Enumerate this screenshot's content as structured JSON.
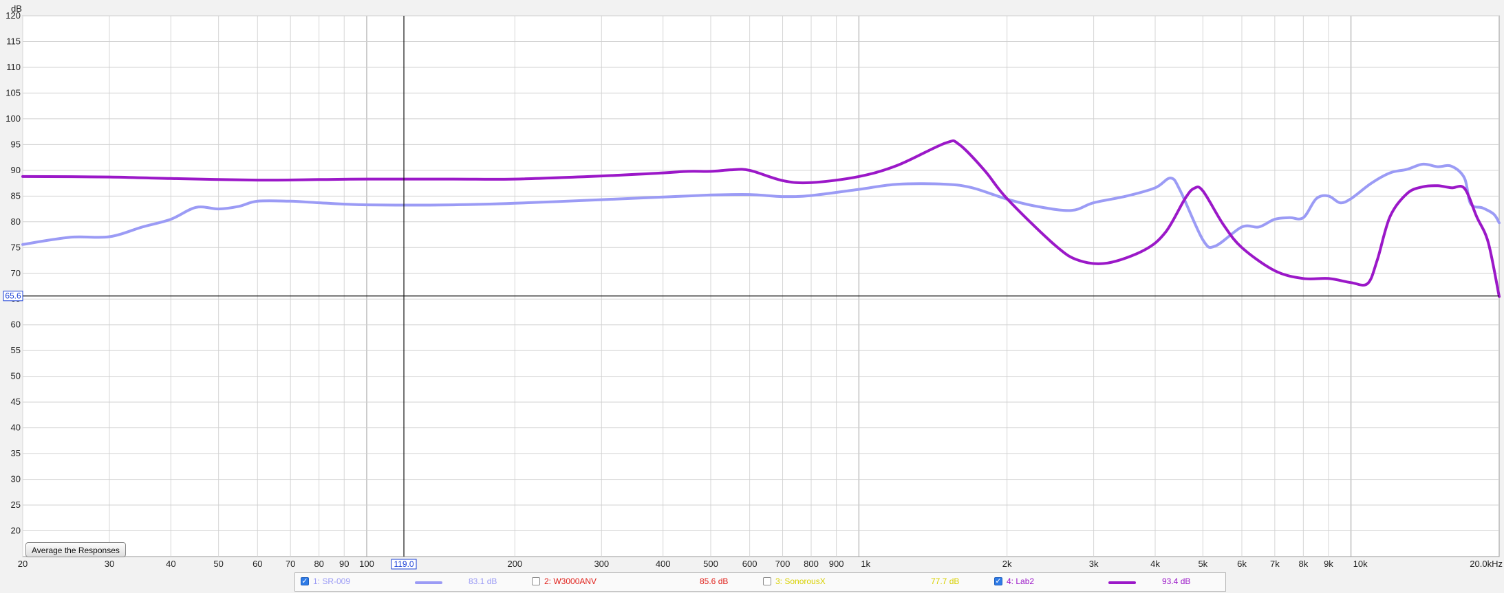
{
  "chart_data": {
    "type": "line",
    "ylabel": "dB",
    "xlim": [
      20,
      20000
    ],
    "ylim": [
      15,
      120
    ],
    "x_scale": "log",
    "grid": true,
    "x_ticks": [
      {
        "v": 20,
        "label": "20"
      },
      {
        "v": 30,
        "label": "30"
      },
      {
        "v": 40,
        "label": "40"
      },
      {
        "v": 50,
        "label": "50"
      },
      {
        "v": 60,
        "label": "60"
      },
      {
        "v": 70,
        "label": "70"
      },
      {
        "v": 80,
        "label": "80"
      },
      {
        "v": 90,
        "label": "90"
      },
      {
        "v": 100,
        "label": "100"
      },
      {
        "v": 200,
        "label": "200"
      },
      {
        "v": 300,
        "label": "300"
      },
      {
        "v": 400,
        "label": "400"
      },
      {
        "v": 500,
        "label": "500"
      },
      {
        "v": 600,
        "label": "600"
      },
      {
        "v": 700,
        "label": "700"
      },
      {
        "v": 800,
        "label": "800"
      },
      {
        "v": 900,
        "label": "900"
      },
      {
        "v": 1000,
        "label": "1k"
      },
      {
        "v": 2000,
        "label": "2k"
      },
      {
        "v": 3000,
        "label": "3k"
      },
      {
        "v": 4000,
        "label": "4k"
      },
      {
        "v": 5000,
        "label": "5k"
      },
      {
        "v": 6000,
        "label": "6k"
      },
      {
        "v": 7000,
        "label": "7k"
      },
      {
        "v": 8000,
        "label": "8k"
      },
      {
        "v": 9000,
        "label": "9k"
      },
      {
        "v": 10000,
        "label": "10k"
      },
      {
        "v": 20000,
        "label": "20.0kHz"
      }
    ],
    "y_ticks": [
      20,
      25,
      30,
      35,
      40,
      45,
      50,
      55,
      60,
      65,
      70,
      75,
      80,
      85,
      90,
      95,
      100,
      105,
      110,
      115,
      120
    ],
    "cursor": {
      "x": 119.0,
      "x_label": "119.0",
      "y": 65.6,
      "y_label": "65.6"
    },
    "series": [
      {
        "name": "SR-009",
        "color": "#9b9bf5",
        "points": [
          [
            20,
            75.6
          ],
          [
            25,
            77.0
          ],
          [
            30,
            77.1
          ],
          [
            35,
            79.0
          ],
          [
            40,
            80.5
          ],
          [
            45,
            82.8
          ],
          [
            50,
            82.5
          ],
          [
            55,
            83.0
          ],
          [
            60,
            84.0
          ],
          [
            70,
            84.0
          ],
          [
            80,
            83.7
          ],
          [
            100,
            83.3
          ],
          [
            150,
            83.3
          ],
          [
            200,
            83.6
          ],
          [
            300,
            84.3
          ],
          [
            400,
            84.8
          ],
          [
            500,
            85.2
          ],
          [
            600,
            85.3
          ],
          [
            700,
            84.9
          ],
          [
            800,
            85.1
          ],
          [
            1000,
            86.3
          ],
          [
            1200,
            87.3
          ],
          [
            1500,
            87.3
          ],
          [
            1700,
            86.6
          ],
          [
            2000,
            84.4
          ],
          [
            2300,
            83.0
          ],
          [
            2700,
            82.2
          ],
          [
            3000,
            83.7
          ],
          [
            3500,
            85.0
          ],
          [
            4000,
            86.6
          ],
          [
            4300,
            88.5
          ],
          [
            4500,
            86.0
          ],
          [
            5000,
            76.5
          ],
          [
            5300,
            75.3
          ],
          [
            6000,
            79.0
          ],
          [
            6500,
            79.0
          ],
          [
            7000,
            80.5
          ],
          [
            7500,
            80.8
          ],
          [
            8000,
            80.8
          ],
          [
            8500,
            84.5
          ],
          [
            9000,
            85.0
          ],
          [
            9500,
            83.7
          ],
          [
            10000,
            84.5
          ],
          [
            11000,
            87.5
          ],
          [
            12000,
            89.5
          ],
          [
            13000,
            90.2
          ],
          [
            14000,
            91.2
          ],
          [
            15000,
            90.7
          ],
          [
            16000,
            90.8
          ],
          [
            17000,
            88.5
          ],
          [
            17500,
            83.5
          ],
          [
            18500,
            82.7
          ],
          [
            19500,
            81.5
          ],
          [
            20000,
            79.8
          ]
        ]
      },
      {
        "name": "Lab2",
        "color": "#9b18c8",
        "points": [
          [
            20,
            88.8
          ],
          [
            30,
            88.7
          ],
          [
            40,
            88.4
          ],
          [
            60,
            88.1
          ],
          [
            80,
            88.2
          ],
          [
            100,
            88.3
          ],
          [
            150,
            88.3
          ],
          [
            200,
            88.3
          ],
          [
            300,
            88.9
          ],
          [
            400,
            89.5
          ],
          [
            450,
            89.8
          ],
          [
            500,
            89.8
          ],
          [
            550,
            90.1
          ],
          [
            600,
            90.0
          ],
          [
            700,
            88.0
          ],
          [
            800,
            87.6
          ],
          [
            1000,
            88.8
          ],
          [
            1200,
            91.0
          ],
          [
            1500,
            95.3
          ],
          [
            1600,
            95.0
          ],
          [
            1800,
            90.0
          ],
          [
            2000,
            84.5
          ],
          [
            2500,
            75.5
          ],
          [
            2800,
            72.5
          ],
          [
            3200,
            72.0
          ],
          [
            3800,
            74.5
          ],
          [
            4200,
            78.0
          ],
          [
            4600,
            84.5
          ],
          [
            4800,
            86.5
          ],
          [
            5000,
            86.0
          ],
          [
            5500,
            79.5
          ],
          [
            6000,
            75.0
          ],
          [
            7000,
            70.5
          ],
          [
            8000,
            69.0
          ],
          [
            9000,
            69.0
          ],
          [
            10000,
            68.2
          ],
          [
            10800,
            68.0
          ],
          [
            11300,
            72.5
          ],
          [
            12000,
            81.0
          ],
          [
            13000,
            85.5
          ],
          [
            14000,
            86.8
          ],
          [
            15000,
            87.0
          ],
          [
            16000,
            86.6
          ],
          [
            17000,
            86.5
          ],
          [
            18000,
            81.0
          ],
          [
            19000,
            76.0
          ],
          [
            20000,
            65.5
          ]
        ]
      }
    ]
  },
  "controls": {
    "average_button": "Average the Responses"
  },
  "legend": [
    {
      "checked": true,
      "name": "1: SR-009",
      "value": "83.1 dB",
      "color": "#9b9bf5",
      "swatch": true
    },
    {
      "checked": false,
      "name": "2: W3000ANV",
      "value": "85.6 dB",
      "color": "#e0201a",
      "swatch": false
    },
    {
      "checked": false,
      "name": "3: SonorousX",
      "value": "77.7 dB",
      "color": "#d8d000",
      "swatch": false
    },
    {
      "checked": true,
      "name": "4: Lab2",
      "value": "93.4 dB",
      "color": "#9b18c8",
      "swatch": true
    }
  ]
}
